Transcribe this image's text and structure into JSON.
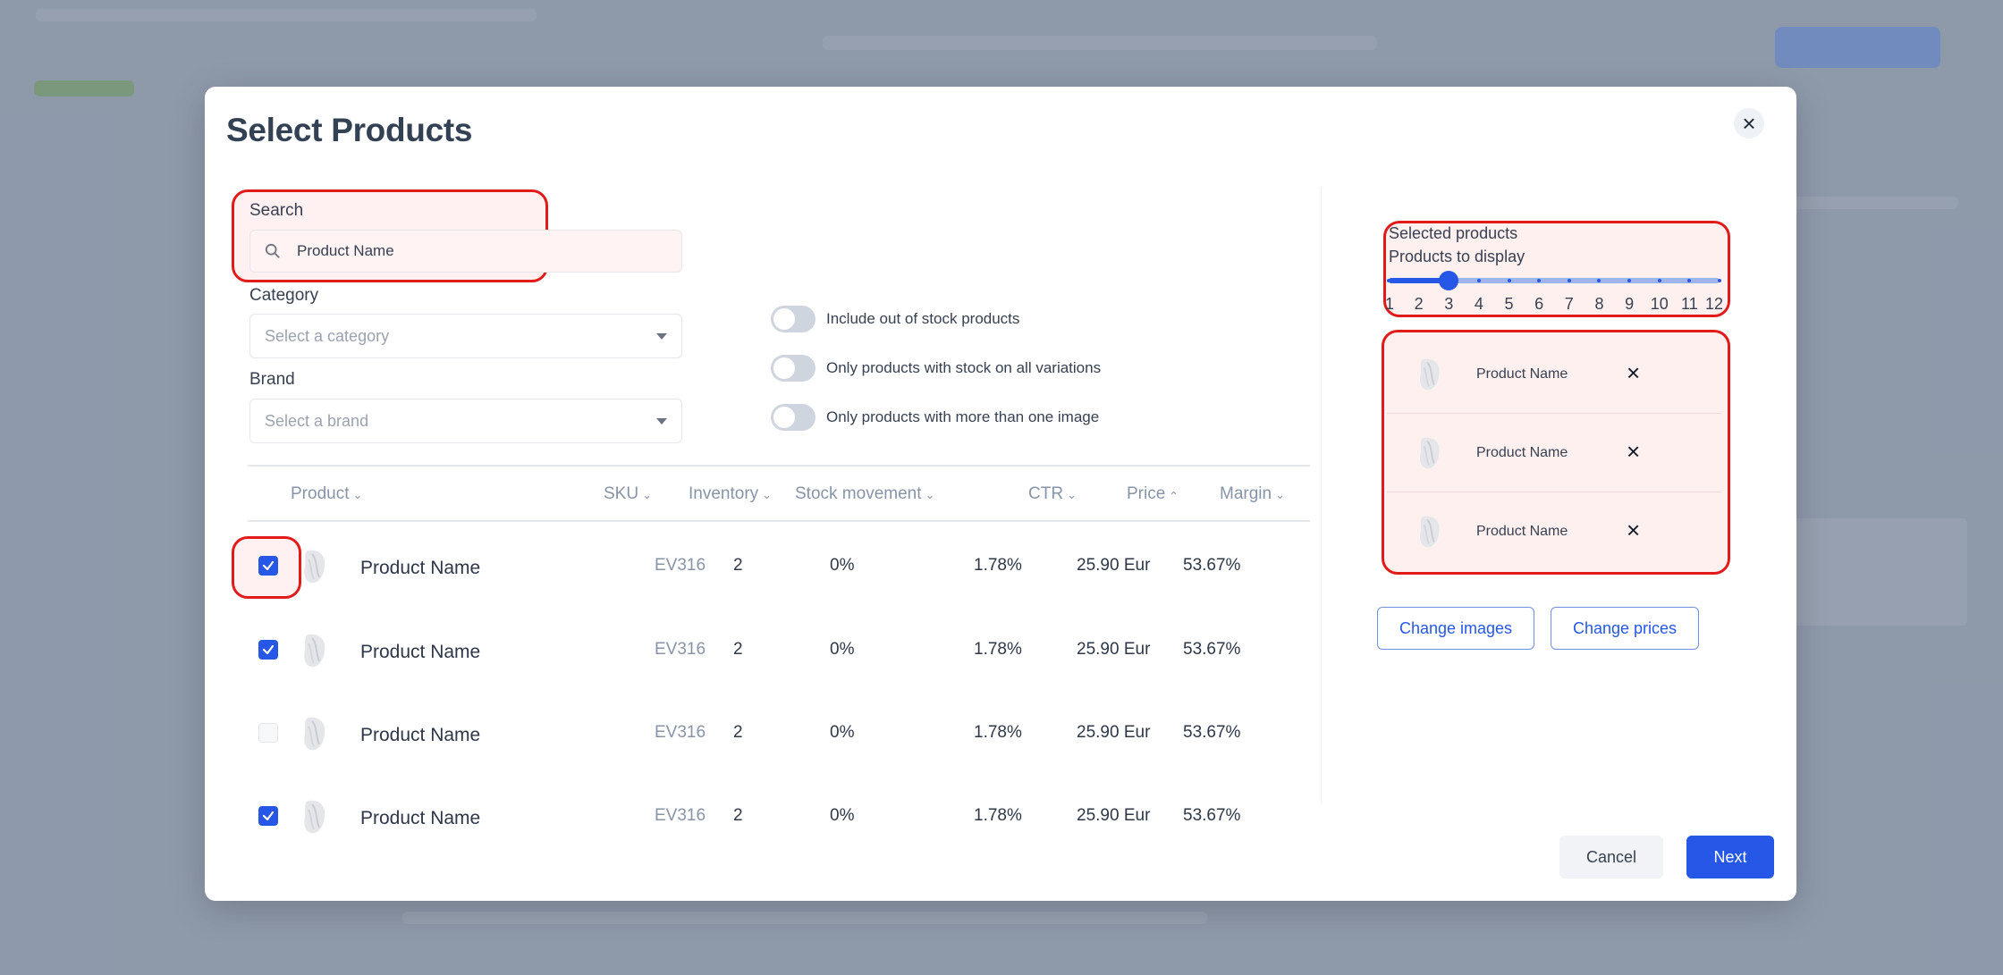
{
  "modal": {
    "title": "Select Products",
    "search": {
      "label": "Search",
      "value": "Product Name"
    },
    "category": {
      "label": "Category",
      "placeholder": "Select a category"
    },
    "brand": {
      "label": "Brand",
      "placeholder": "Select a brand"
    },
    "toggles": [
      {
        "label": "Include out of stock products",
        "on": false
      },
      {
        "label": "Only products with stock on all variations",
        "on": false
      },
      {
        "label": "Only products with more than one image",
        "on": false
      }
    ],
    "table": {
      "columns": [
        "Product",
        "SKU",
        "Inventory",
        "Stock movement",
        "CTR",
        "Price",
        "Margin"
      ],
      "rows": [
        {
          "checked": true,
          "name": "Product Name",
          "sku": "EV316",
          "inventory": "2",
          "stock_movement": "0%",
          "ctr": "1.78%",
          "price": "25.90 Eur",
          "margin": "53.67%"
        },
        {
          "checked": true,
          "name": "Product Name",
          "sku": "EV316",
          "inventory": "2",
          "stock_movement": "0%",
          "ctr": "1.78%",
          "price": "25.90 Eur",
          "margin": "53.67%"
        },
        {
          "checked": false,
          "name": "Product Name",
          "sku": "EV316",
          "inventory": "2",
          "stock_movement": "0%",
          "ctr": "1.78%",
          "price": "25.90 Eur",
          "margin": "53.67%"
        },
        {
          "checked": true,
          "name": "Product Name",
          "sku": "EV316",
          "inventory": "2",
          "stock_movement": "0%",
          "ctr": "1.78%",
          "price": "25.90 Eur",
          "margin": "53.67%"
        }
      ]
    },
    "side": {
      "selected_label": "Selected products",
      "display_label": "Products to display",
      "slider_value": 3,
      "ticks": [
        "1",
        "2",
        "3",
        "4",
        "5",
        "6",
        "7",
        "8",
        "9",
        "10",
        "11",
        "12"
      ],
      "selected": [
        {
          "name": "Product Name"
        },
        {
          "name": "Product Name"
        },
        {
          "name": "Product Name"
        }
      ],
      "change_images": "Change images",
      "change_prices": "Change prices"
    },
    "footer": {
      "cancel": "Cancel",
      "next": "Next"
    }
  },
  "colors": {
    "accent": "#2657e6",
    "highlight": "#e11a1a"
  }
}
